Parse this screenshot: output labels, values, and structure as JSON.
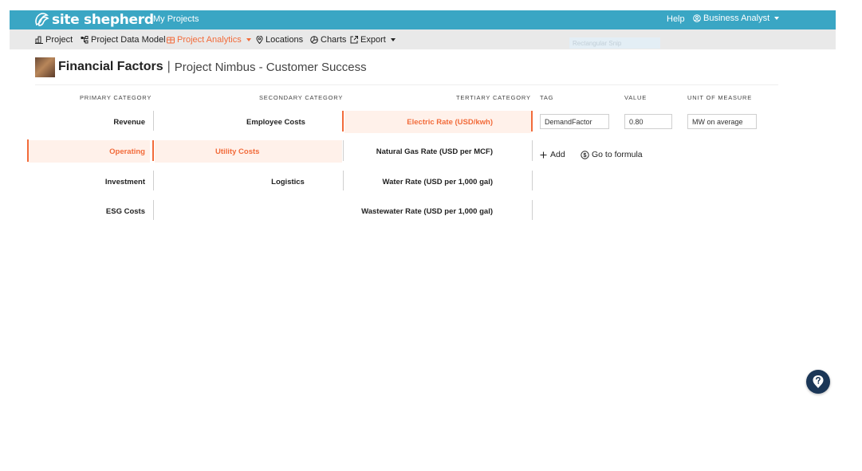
{
  "header": {
    "logo_text": "site shepherd",
    "my_projects": "My Projects",
    "help": "Help",
    "user": "Business Analyst"
  },
  "nav": {
    "items": [
      {
        "label": "Project",
        "icon": "building-icon"
      },
      {
        "label": "Project Data Model",
        "icon": "data-model-icon"
      },
      {
        "label": "Project Analytics",
        "icon": "analytics-icon",
        "active": true
      },
      {
        "label": "Locations",
        "icon": "map-pin-icon"
      },
      {
        "label": "Charts",
        "icon": "pie-chart-icon"
      },
      {
        "label": "Export",
        "icon": "export-icon"
      }
    ],
    "ghost_label": "Rectangular Snip"
  },
  "page": {
    "title": "Financial Factors",
    "separator": "|",
    "project_name": "Project Nimbus - Customer Success"
  },
  "columns": {
    "primary": "PRIMARY CATEGORY",
    "secondary": "SECONDARY CATEGORY",
    "tertiary": "TERTIARY CATEGORY",
    "tag": "TAG",
    "value": "VALUE",
    "unit": "UNIT OF MEASURE"
  },
  "primary": [
    "Revenue",
    "Operating",
    "Investment",
    "ESG Costs"
  ],
  "secondary": [
    "Employee Costs",
    "Utility Costs",
    "Logistics"
  ],
  "tertiary": [
    "Electric Rate (USD/kwh)",
    "Natural Gas Rate (USD per MCF)",
    "Water Rate (USD per 1,000 gal)",
    "Wastewater Rate (USD per 1,000 gal)"
  ],
  "detail": {
    "tag": "DemandFactor",
    "value": "0.80",
    "unit": "MW on average",
    "add": "Add",
    "formula": "Go to formula"
  },
  "colors": {
    "topbar": "#3aa6c4",
    "accent": "#f26b3a",
    "selected_bg": "#fff1ea",
    "fab": "#1a3657"
  }
}
